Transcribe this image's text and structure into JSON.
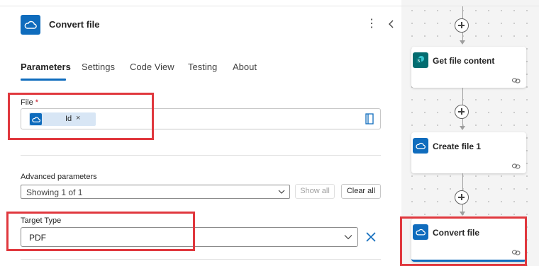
{
  "panel": {
    "title": "Convert file",
    "tabs": [
      {
        "label": "Parameters",
        "active": true
      },
      {
        "label": "Settings",
        "active": false
      },
      {
        "label": "Code View",
        "active": false
      },
      {
        "label": "Testing",
        "active": false
      },
      {
        "label": "About",
        "active": false
      }
    ],
    "file_field": {
      "label": "File",
      "required_mark": "*",
      "token_label": "Id",
      "token_remove": "×"
    },
    "advanced": {
      "label": "Advanced parameters",
      "selected": "Showing 1 of 1",
      "show_all": "Show all",
      "clear_all": "Clear all"
    },
    "target_type": {
      "label": "Target Type",
      "selected": "PDF"
    },
    "more_icon": "⋮"
  },
  "flow": {
    "cards": [
      {
        "title": "Get file content",
        "icon": "sharepoint-icon",
        "color": "#036c70"
      },
      {
        "title": "Create file 1",
        "icon": "onedrive-icon",
        "color": "#0f6cbd"
      },
      {
        "title": "Convert file",
        "icon": "onedrive-icon",
        "color": "#0f6cbd"
      }
    ]
  },
  "colors": {
    "accent": "#0f6cbd",
    "highlight": "#e0383e"
  }
}
